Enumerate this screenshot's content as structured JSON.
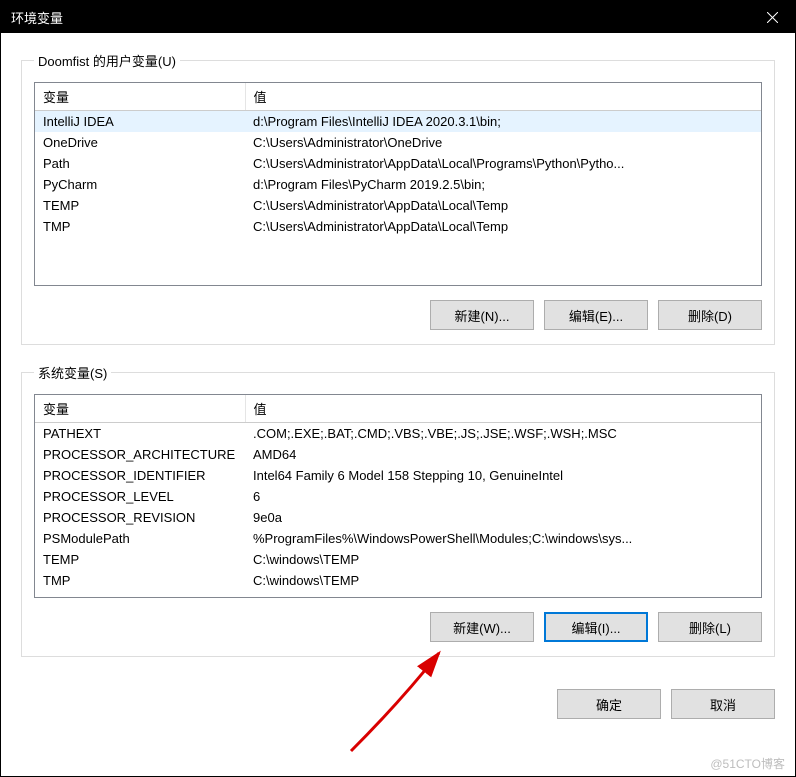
{
  "title": "环境变量",
  "user_section": {
    "legend": "Doomfist 的用户变量(U)",
    "headers": {
      "var": "变量",
      "val": "值"
    },
    "rows": [
      {
        "var": "IntelliJ IDEA",
        "val": "d:\\Program Files\\IntelliJ IDEA 2020.3.1\\bin;",
        "selected": true
      },
      {
        "var": "OneDrive",
        "val": "C:\\Users\\Administrator\\OneDrive"
      },
      {
        "var": "Path",
        "val": "C:\\Users\\Administrator\\AppData\\Local\\Programs\\Python\\Pytho..."
      },
      {
        "var": "PyCharm",
        "val": "d:\\Program Files\\PyCharm 2019.2.5\\bin;"
      },
      {
        "var": "TEMP",
        "val": "C:\\Users\\Administrator\\AppData\\Local\\Temp"
      },
      {
        "var": "TMP",
        "val": "C:\\Users\\Administrator\\AppData\\Local\\Temp"
      }
    ],
    "buttons": {
      "new": "新建(N)...",
      "edit": "编辑(E)...",
      "delete": "删除(D)"
    }
  },
  "system_section": {
    "legend": "系统变量(S)",
    "headers": {
      "var": "变量",
      "val": "值"
    },
    "rows": [
      {
        "var": "PATHEXT",
        "val": ".COM;.EXE;.BAT;.CMD;.VBS;.VBE;.JS;.JSE;.WSF;.WSH;.MSC"
      },
      {
        "var": "PROCESSOR_ARCHITECTURE",
        "val": "AMD64"
      },
      {
        "var": "PROCESSOR_IDENTIFIER",
        "val": "Intel64 Family 6 Model 158 Stepping 10, GenuineIntel"
      },
      {
        "var": "PROCESSOR_LEVEL",
        "val": "6"
      },
      {
        "var": "PROCESSOR_REVISION",
        "val": "9e0a"
      },
      {
        "var": "PSModulePath",
        "val": "%ProgramFiles%\\WindowsPowerShell\\Modules;C:\\windows\\sys..."
      },
      {
        "var": "TEMP",
        "val": "C:\\windows\\TEMP"
      },
      {
        "var": "TMP",
        "val": "C:\\windows\\TEMP"
      }
    ],
    "buttons": {
      "new": "新建(W)...",
      "edit": "编辑(I)...",
      "delete": "删除(L)"
    }
  },
  "footer": {
    "ok": "确定",
    "cancel": "取消"
  },
  "watermark": "@51CTO博客"
}
